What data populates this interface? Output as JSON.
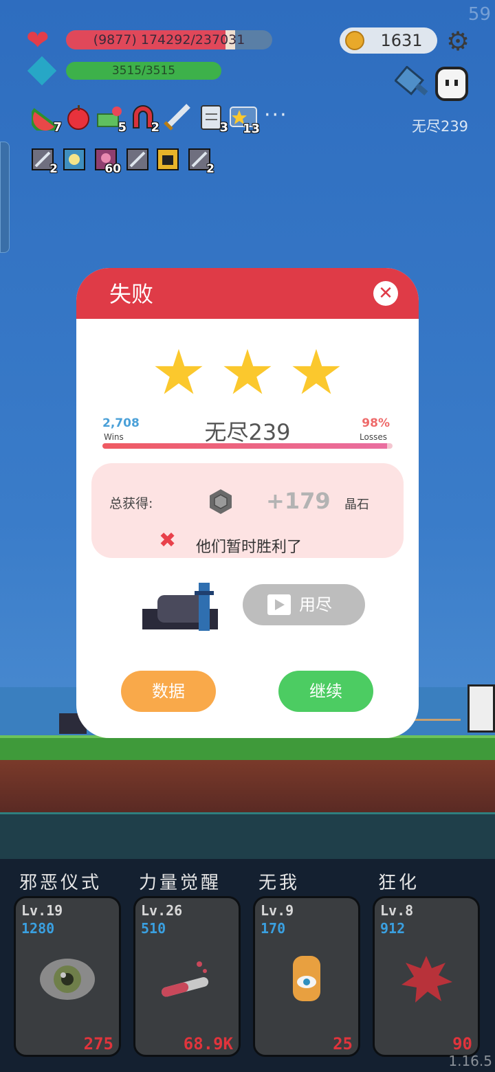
{
  "hud": {
    "fps": "59",
    "hp_text": "(9877) 174292/237031",
    "hp_fraction": 0.735,
    "mp_text": "3515/3515",
    "mp_fraction": 1.0,
    "coins": "1631",
    "settings_icon": "gear-icon",
    "endless_label": "无尽239",
    "items": [
      {
        "icon": "watermelon-icon",
        "count": "7"
      },
      {
        "icon": "apple-icon",
        "count": ""
      },
      {
        "icon": "money-heart-icon",
        "count": "5"
      },
      {
        "icon": "magnet-icon",
        "count": "2"
      },
      {
        "icon": "sword-icon",
        "count": ""
      },
      {
        "icon": "clipboard-icon",
        "count": "3"
      },
      {
        "icon": "star-ticket-icon",
        "count": "13"
      }
    ],
    "more_label": "···",
    "relics": [
      {
        "icon": "relic-slash-icon",
        "count": "2"
      },
      {
        "icon": "relic-sun-icon",
        "count": ""
      },
      {
        "icon": "relic-flower-icon",
        "count": "60"
      },
      {
        "icon": "relic-slash-icon",
        "count": ""
      },
      {
        "icon": "relic-face-icon",
        "count": ""
      },
      {
        "icon": "relic-slash-icon",
        "count": "2"
      }
    ]
  },
  "dialog": {
    "title": "失败",
    "stars": 3,
    "wins_value": "2,708",
    "wins_label": "Wins",
    "losses_value": "98%",
    "losses_label": "Losses",
    "stage_name": "无尽239",
    "progress_fraction": 0.98,
    "reward_label": "总获得:",
    "reward_amount": "+179",
    "reward_unit": "晶石",
    "fail_message": "他们暂时胜利了",
    "ad_button_label": "用尽",
    "data_button_label": "数据",
    "continue_button_label": "继续"
  },
  "skills": [
    {
      "name": "邪恶仪式",
      "level": "Lv.19",
      "value": "1280",
      "cost": "275",
      "icon": "eye-icon"
    },
    {
      "name": "力量觉醒",
      "level": "Lv.26",
      "value": "510",
      "cost": "68.9K",
      "icon": "potion-tube-icon"
    },
    {
      "name": "无我",
      "level": "Lv.9",
      "value": "170",
      "cost": "25",
      "icon": "hamsa-hand-icon"
    },
    {
      "name": "狂化",
      "level": "Lv.8",
      "value": "912",
      "cost": "90",
      "icon": "blood-splat-icon"
    }
  ],
  "version": "1.16.5",
  "colors": {
    "header_red": "#df3b47",
    "star_yellow": "#fbc82d",
    "data_orange": "#f9a94a",
    "continue_green": "#4ccc62",
    "cost_red": "#e0343c",
    "level_blue": "#3aa0e0"
  }
}
